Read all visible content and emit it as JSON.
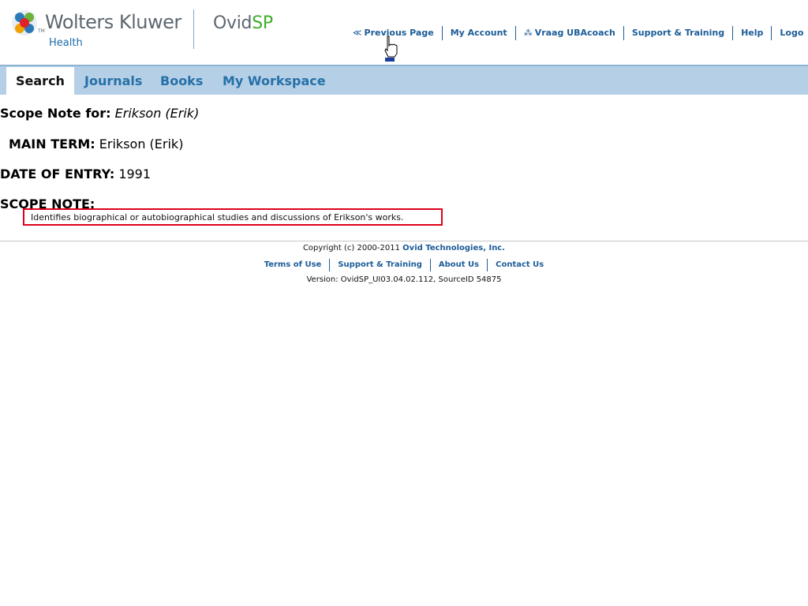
{
  "header": {
    "brand_name": "Wolters Kluwer",
    "brand_tm": "TM",
    "brand_sub": "Health",
    "product_prefix": "Ovid",
    "product_suffix": "SP",
    "links": [
      {
        "label": "Previous Page",
        "icon": "double-left-chevron-icon"
      },
      {
        "label": "My Account"
      },
      {
        "label": "Vraag UBAcoach",
        "icon": "help-person-icon"
      },
      {
        "label": "Support & Training"
      },
      {
        "label": "Help"
      },
      {
        "label": "Logo"
      }
    ]
  },
  "nav": {
    "tabs": [
      {
        "label": "Search",
        "active": true
      },
      {
        "label": "Journals"
      },
      {
        "label": "Books"
      },
      {
        "label": "My Workspace"
      }
    ]
  },
  "scope": {
    "for_label": "Scope Note for:",
    "for_value": "Erikson (Erik)",
    "main_term_label": "MAIN TERM:",
    "main_term_value": "Erikson (Erik)",
    "date_label": "DATE OF ENTRY:",
    "date_value": "1991",
    "note_label": "SCOPE NOTE:",
    "note_text": "Identifies biographical or autobiographical studies and discussions of Erikson's works."
  },
  "footer": {
    "copyright_prefix": "Copyright (c) 2000-2011",
    "company": "Ovid Technologies, Inc.",
    "links": [
      "Terms of Use",
      "Support & Training",
      "About Us",
      "Contact Us"
    ],
    "version": "Version: OvidSP_UI03.04.02.112, SourceID 54875"
  },
  "colors": {
    "link": "#1c5c98",
    "navbar": "#b5d0e6",
    "highlight_box": "#e0001a",
    "ovid_sp": "#3dae2b"
  }
}
